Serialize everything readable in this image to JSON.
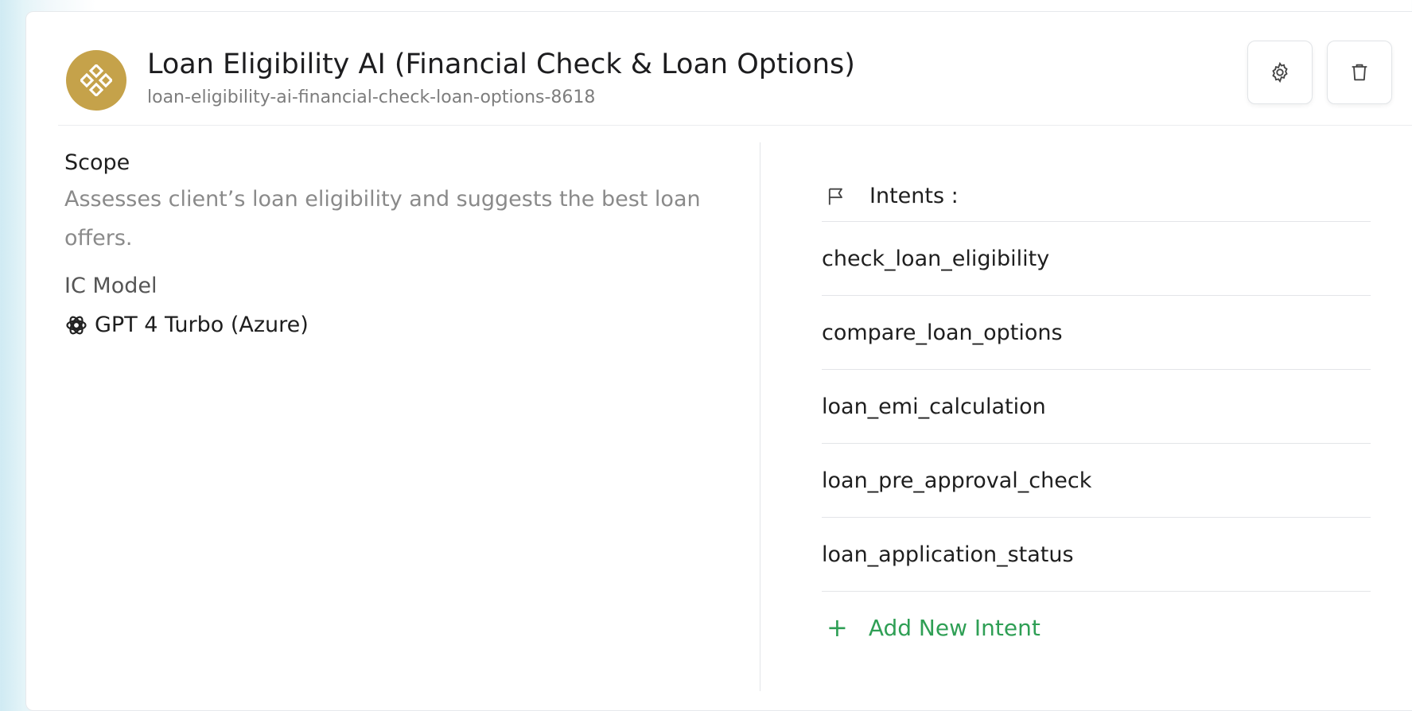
{
  "agent": {
    "title": "Loan Eligibility AI (Financial Check & Loan Options)",
    "slug": "loan-eligibility-ai-financial-check-loan-options-8618",
    "avatar_color": "#c5a24a",
    "avatar_icon": "diamonds-icon"
  },
  "actions": {
    "settings_icon": "gear-icon",
    "delete_icon": "trash-icon"
  },
  "scope": {
    "label": "Scope",
    "text": "Assesses client’s loan eligibility and suggests the best loan offers."
  },
  "ic_model": {
    "label": "IC Model",
    "value": "GPT 4 Turbo (Azure)",
    "icon": "openai-icon"
  },
  "intents": {
    "label": "Intents :",
    "icon": "flag-icon",
    "items": [
      "check_loan_eligibility",
      "compare_loan_options",
      "loan_emi_calculation",
      "loan_pre_approval_check",
      "loan_application_status"
    ],
    "add_label": "Add New Intent",
    "add_color": "#2f9f55"
  }
}
